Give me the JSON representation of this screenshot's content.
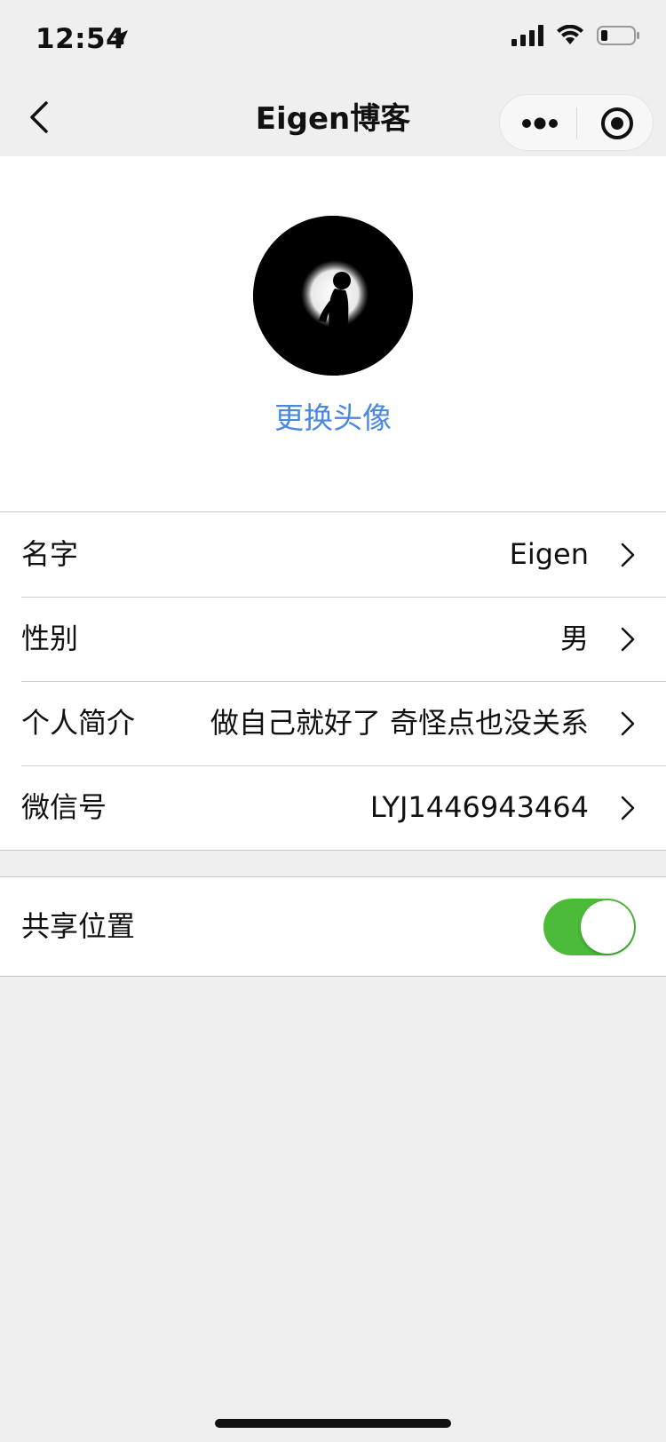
{
  "status_bar": {
    "time": "12:54",
    "icons": [
      "location-arrow-icon",
      "signal-icon",
      "wifi-icon",
      "battery-icon"
    ]
  },
  "nav": {
    "title": "Eigen博客",
    "icons": [
      "back-chevron-icon",
      "more-dots-icon",
      "close-target-icon"
    ]
  },
  "profile": {
    "change_avatar_label": "更换头像"
  },
  "info_rows": [
    {
      "label": "名字",
      "value": "Eigen"
    },
    {
      "label": "性别",
      "value": "男"
    },
    {
      "label": "个人简介",
      "value": "做自己就好了 奇怪点也没关系"
    },
    {
      "label": "微信号",
      "value": "LYJ1446943464"
    }
  ],
  "share_location": {
    "label": "共享位置",
    "enabled": true
  },
  "colors": {
    "accent_blue": "#4a88e0",
    "toggle_green": "#4dbb3a",
    "background": "#efefef"
  }
}
